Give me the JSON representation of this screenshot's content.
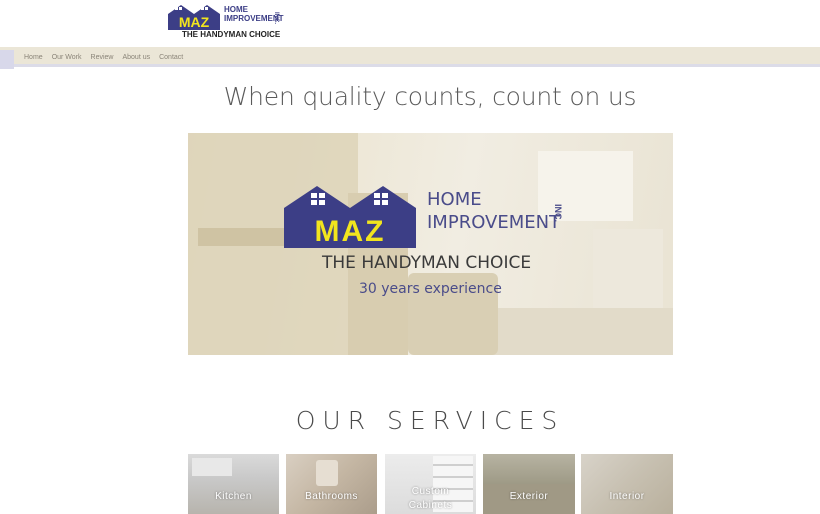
{
  "logo": {
    "line1": "HOME",
    "line2": "IMPROVEMENT",
    "inc": "INC.",
    "mark": "MAZ",
    "tagline": "THE HANDYMAN CHOICE"
  },
  "nav": {
    "items": [
      {
        "label": "Home"
      },
      {
        "label": "Our Work"
      },
      {
        "label": "Review"
      },
      {
        "label": "About us"
      },
      {
        "label": "Contact"
      }
    ]
  },
  "headline": "When quality counts, count on us",
  "hero": {
    "mark": "MAZ",
    "line1": "HOME",
    "line2": "IMPROVEMENT",
    "inc": "INC.",
    "tagline": "THE HANDYMAN CHOICE",
    "experience": "30 years experience"
  },
  "services": {
    "title": "OUR SERVICES",
    "tiles": [
      {
        "label": "Kitchen"
      },
      {
        "label": "Bathrooms"
      },
      {
        "label": "Custom Cabinets"
      },
      {
        "label": "Exterior"
      },
      {
        "label": "Interior"
      }
    ]
  },
  "colors": {
    "brand_navy": "#3c3e86",
    "brand_yellow": "#f2e51e",
    "nav_bg": "#ebe6d7"
  }
}
